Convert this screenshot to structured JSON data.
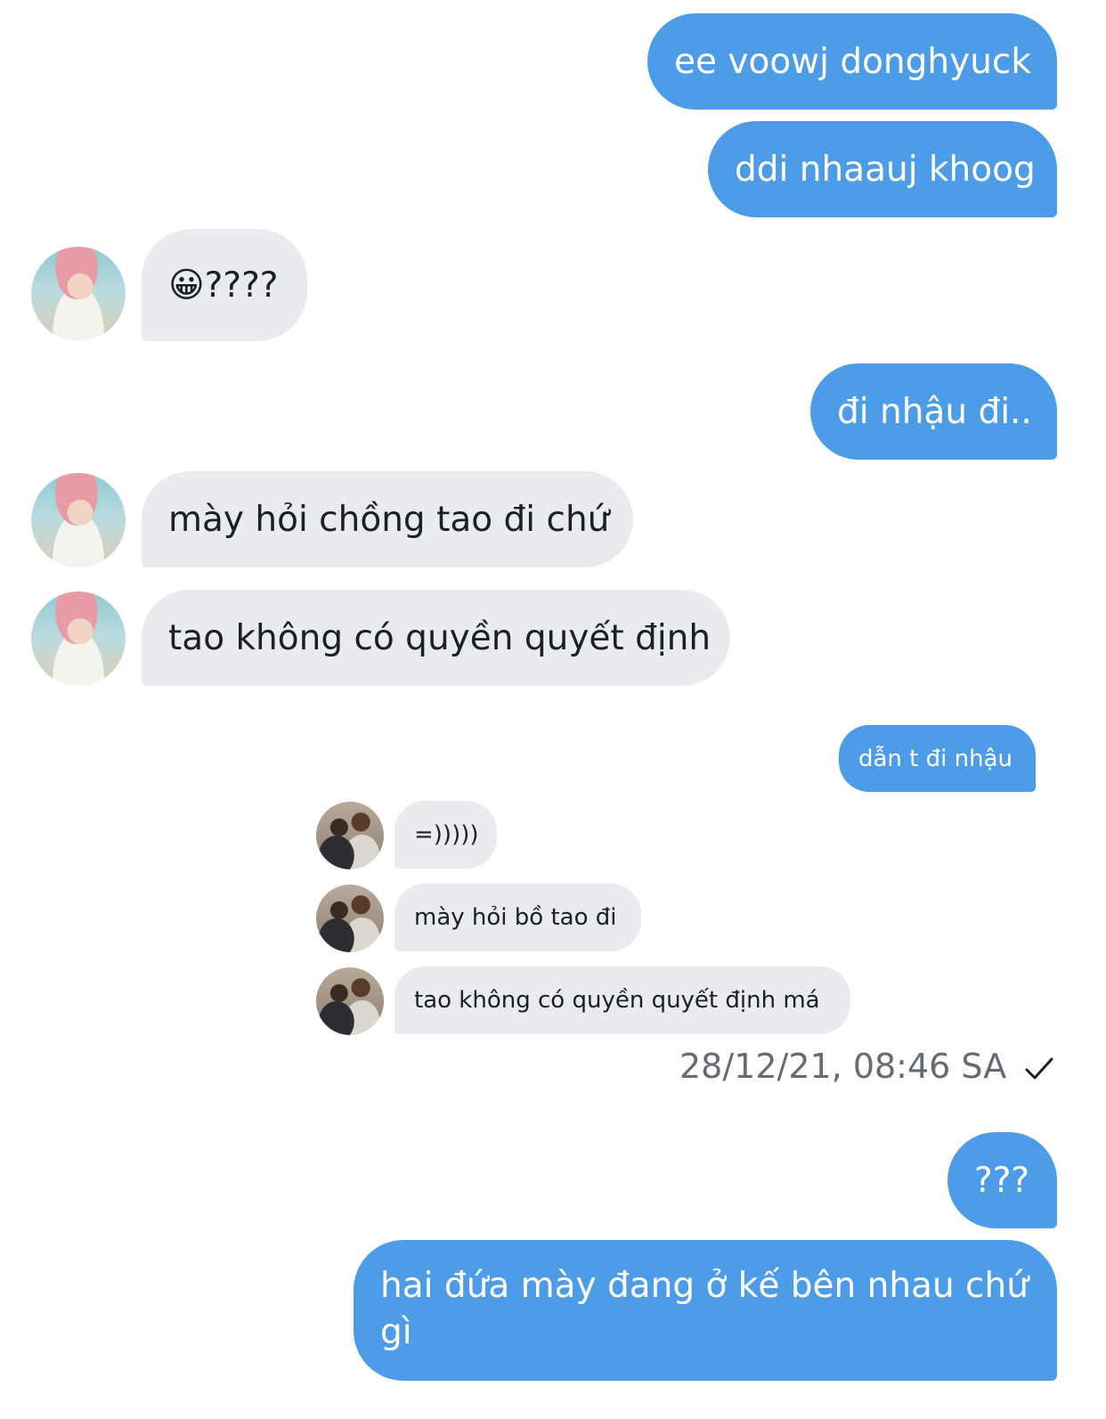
{
  "messages": {
    "m1": "ee voowj donghyuck",
    "m2": "ddi nhaauj khoog",
    "m3_emoji": "😀",
    "m3_text": "????",
    "m4": "đi nhậu đi..",
    "m5": "mày hỏi chồng tao đi chứ",
    "m6": "tao không có quyền quyết định",
    "m7": "dẫn t đi nhậu",
    "m8": "=)))))",
    "m9": "mày hỏi bồ tao đi",
    "m10": "tao không có quyền quyết định má",
    "m11": "???",
    "m12": "hai đứa mày đang ở kế bên nhau chứ gì"
  },
  "status": {
    "timestamp": "28/12/21, 08:46 SA",
    "icon": "checkmark-icon"
  },
  "colors": {
    "outgoing_bubble": "#4c9ce8",
    "incoming_bubble": "#eaebef",
    "timestamp_text": "#666b73"
  }
}
